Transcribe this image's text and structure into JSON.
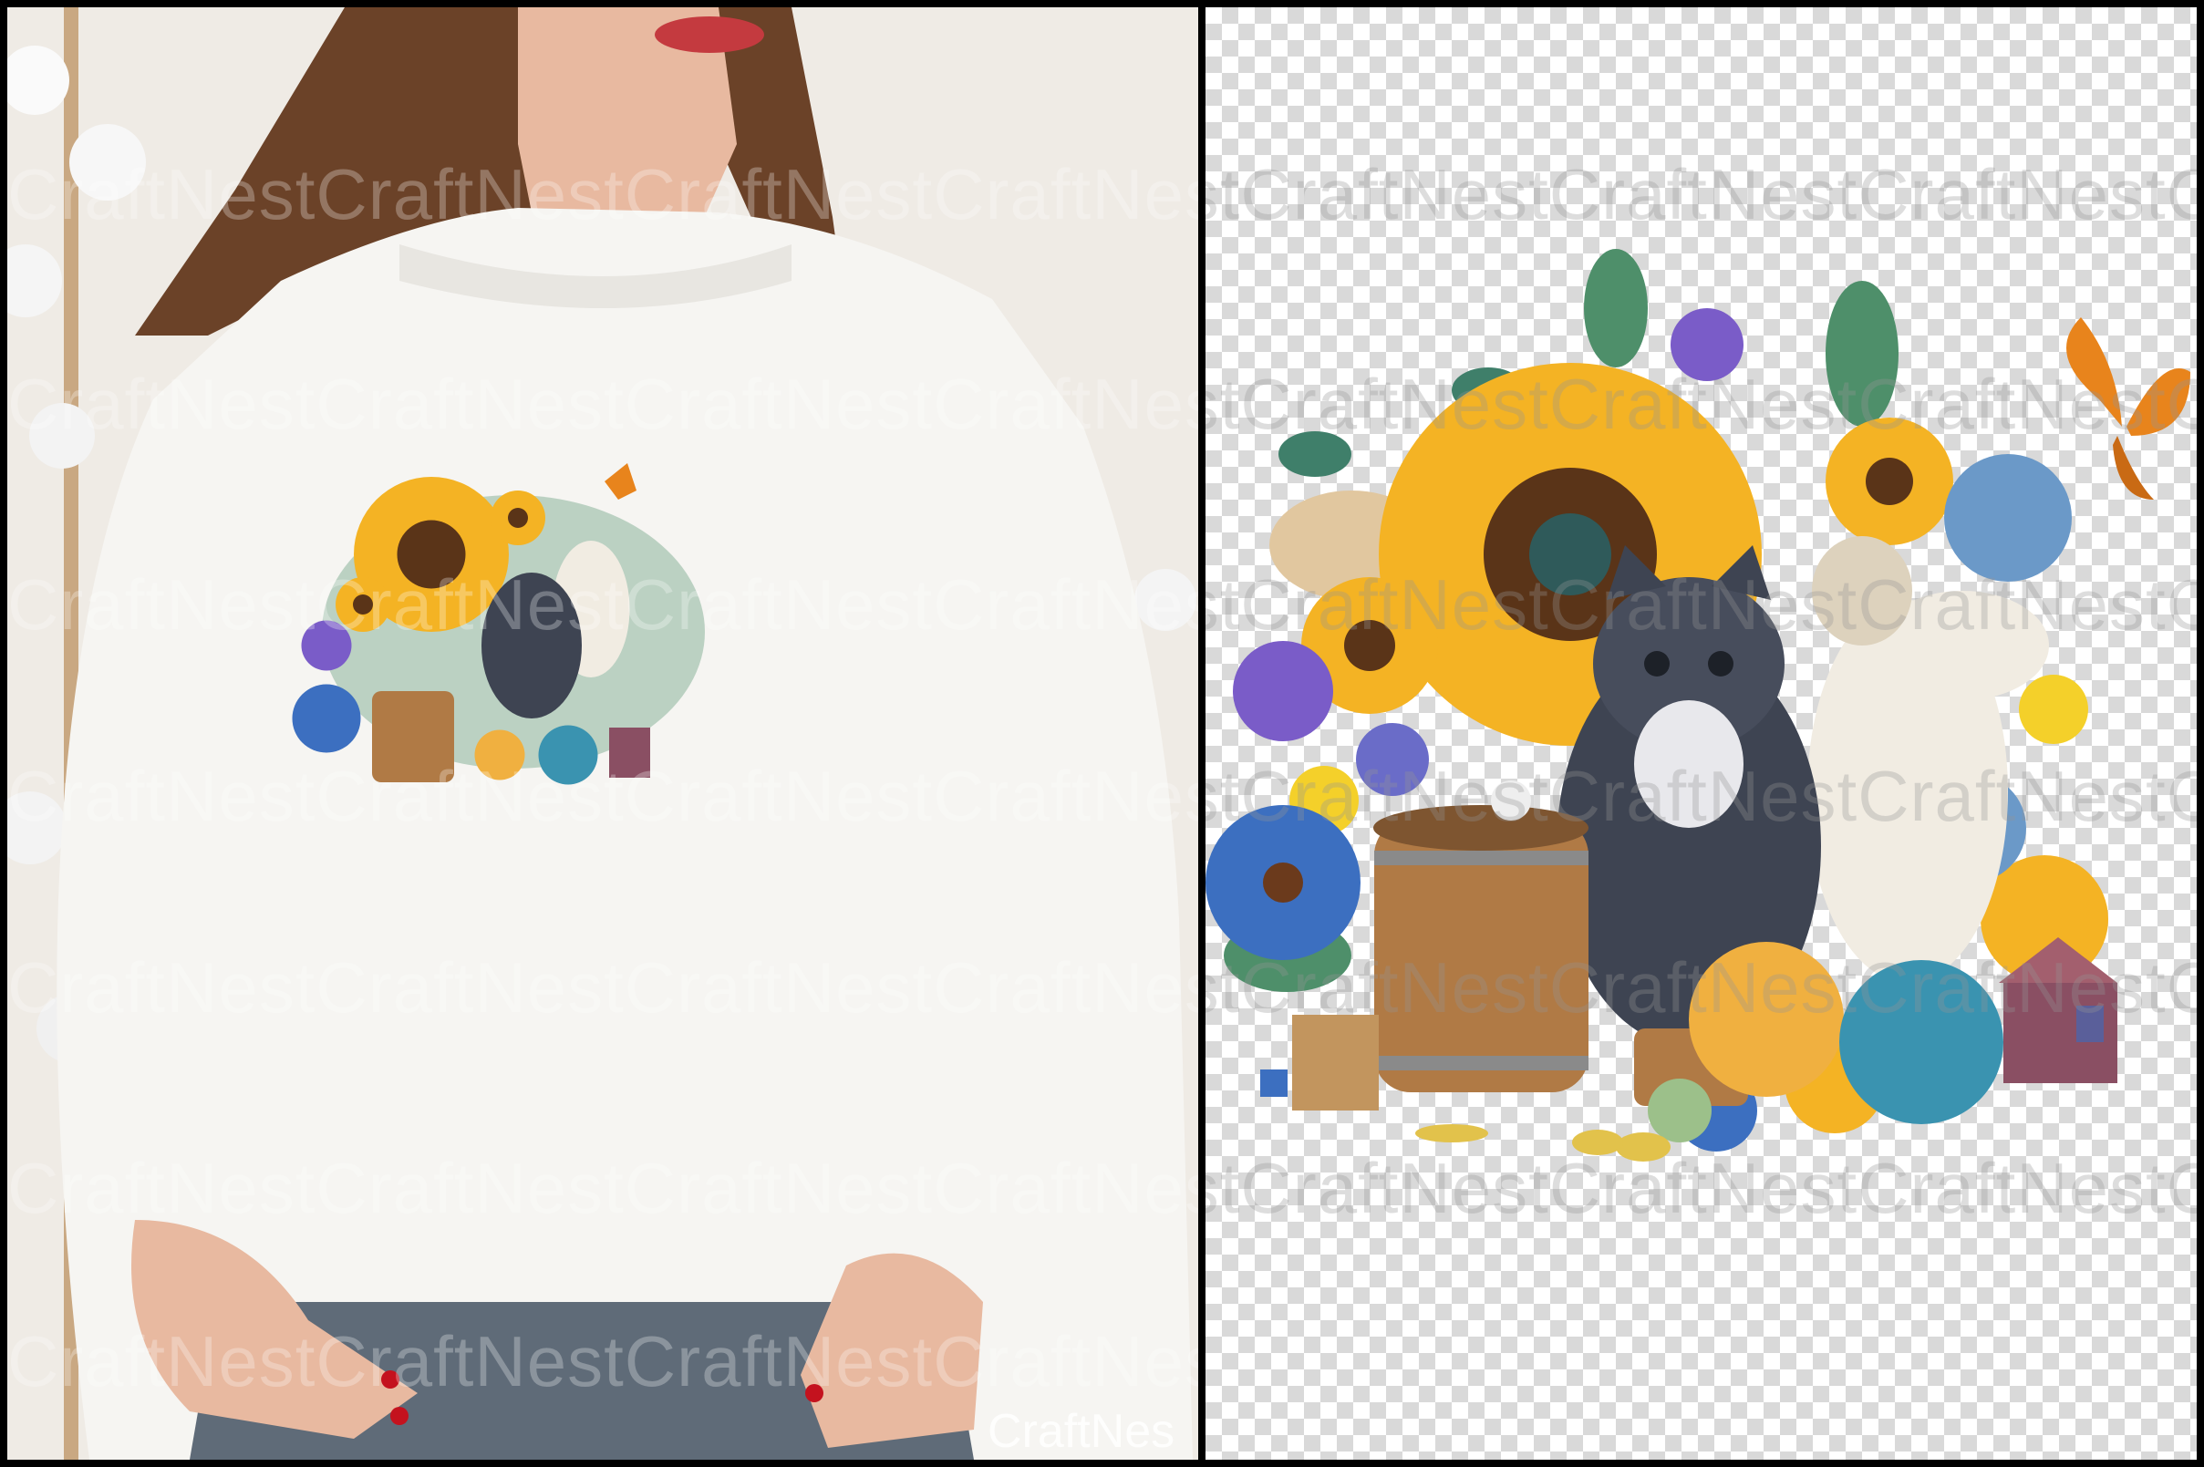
{
  "watermark": {
    "text": "CraftNestCraftNestCraftNestCraftNestCraftNest",
    "credit": "CraftNes"
  },
  "left_panel": {
    "subject": "woman-in-white-sweatshirt",
    "colors": {
      "background": "#eeeae4",
      "sweatshirt": "#f6f5f2",
      "hair": "#6b4228",
      "skin": "#e8b9a0",
      "nails": "#c4121e",
      "jeans": "#5f6b78"
    }
  },
  "right_panel": {
    "subject": "artwork-on-transparency-grid",
    "colors": {
      "checker_light": "#ffffff",
      "checker_dark": "#d9d9d9"
    }
  },
  "artwork": {
    "elements": [
      "sunflower",
      "gray-kitten",
      "white-horse",
      "wooden-barrel",
      "yarn-balls",
      "butterfly",
      "blue-flowers",
      "purple-flowers",
      "leaves",
      "small-house"
    ],
    "colors": {
      "sunflower_petal": "#f4b324",
      "sunflower_center": "#5a3418",
      "kitten": "#3e4452",
      "horse": "#f1ece2",
      "barrel": "#b07a45",
      "yarn_orange": "#f0b040",
      "yarn_teal": "#3a93b0",
      "butterfly": "#e8841c",
      "blue_flower": "#3c6fc0",
      "purple_flower": "#7a5cc8",
      "leaf": "#4e8f6a",
      "house": "#8a4f63"
    }
  }
}
